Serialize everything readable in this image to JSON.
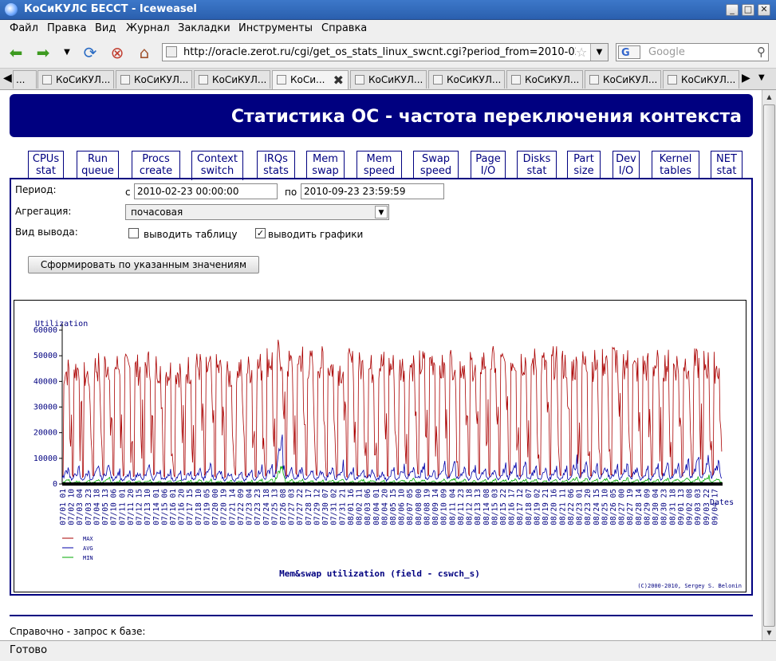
{
  "window": {
    "title": "КоСиКУЛС БЕССТ - Iceweasel"
  },
  "menu": [
    "Файл",
    "Правка",
    "Вид",
    "Журнал",
    "Закладки",
    "Инструменты",
    "Справка"
  ],
  "navbar": {
    "url": "http://oracle.zerot.ru/cgi/get_os_stats_linux_swcnt.cgi?period_from=2010-02-",
    "search_placeholder": "Google",
    "search_engine": "G"
  },
  "tabs": [
    {
      "label": "..."
    },
    {
      "label": "КоСиКУЛ..."
    },
    {
      "label": "КоСиКУЛ..."
    },
    {
      "label": "КоСиКУЛ..."
    },
    {
      "label": "КоСи..."
    },
    {
      "label": "КоСиКУЛ..."
    },
    {
      "label": "КоСиКУЛ..."
    },
    {
      "label": "КоСиКУЛ..."
    },
    {
      "label": "КоСиКУЛ..."
    },
    {
      "label": "КоСиКУЛ..."
    }
  ],
  "page": {
    "title": "Статистика ОС - частота переключения контекста",
    "subtabs": [
      {
        "l1": "CPUs",
        "l2": "stat"
      },
      {
        "l1": "Run",
        "l2": "queue"
      },
      {
        "l1": "Procs",
        "l2": "create"
      },
      {
        "l1": "Context",
        "l2": "switch"
      },
      {
        "l1": "IRQs",
        "l2": "stats"
      },
      {
        "l1": "Mem",
        "l2": "swap"
      },
      {
        "l1": "Mem",
        "l2": "speed"
      },
      {
        "l1": "Swap",
        "l2": "speed"
      },
      {
        "l1": "Page",
        "l2": "I/O"
      },
      {
        "l1": "Disks",
        "l2": "stat"
      },
      {
        "l1": "Part",
        "l2": "size"
      },
      {
        "l1": "Dev",
        "l2": "I/O"
      },
      {
        "l1": "Kernel",
        "l2": "tables"
      },
      {
        "l1": "NET",
        "l2": "stat"
      }
    ],
    "form": {
      "period_label": "Период:",
      "from_prefix": "с",
      "from_value": "2010-02-23 00:00:00",
      "to_prefix": "по",
      "to_value": "2010-09-23 23:59:59",
      "aggregation_label": "Агрегация:",
      "aggregation_value": "почасовая",
      "output_label": "Вид вывода:",
      "table_checkbox": "выводить таблицу",
      "graph_checkbox": "выводить графики",
      "table_checked": false,
      "graph_checked": true,
      "submit": "Сформировать по указанным значениям"
    },
    "note": "Справочно - запрос к базе:"
  },
  "chart_data": {
    "type": "line",
    "title": "Mem&swap utilization (field - cswch_s)",
    "ylabel": "Utilization",
    "xlabel": "Dates",
    "copyright": "(C)2000-2010, Sergey S. Belonin",
    "ylim": [
      0,
      60000
    ],
    "yticks": [
      0,
      10000,
      20000,
      30000,
      40000,
      50000,
      60000
    ],
    "x": [
      "07/01",
      "07/02",
      "07/03",
      "07/04",
      "07/05",
      "07/06",
      "07/08",
      "07/09",
      "07/10",
      "07/11",
      "07/12",
      "07/13",
      "07/14",
      "07/15",
      "07/16",
      "07/17",
      "07/18",
      "07/19",
      "07/20",
      "07/21",
      "07/22",
      "07/23",
      "07/24",
      "07/25",
      "07/26",
      "07/27",
      "07/28",
      "07/29",
      "07/30",
      "07/31",
      "08/01",
      "08/02",
      "08/03",
      "08/04",
      "08/05",
      "08/06",
      "08/07",
      "08/08",
      "08/09",
      "08/10",
      "08/11",
      "08/12",
      "08/13",
      "08/14",
      "08/15",
      "08/16",
      "08/17",
      "08/18",
      "08/19",
      "08/20",
      "08/21",
      "08/22",
      "08/23",
      "08/24",
      "08/25",
      "08/26",
      "08/27",
      "08/28",
      "08/29",
      "08/30",
      "08/31",
      "09/01",
      "09/02",
      "09/03",
      "09/04"
    ],
    "xtick_labels": [
      "07/01 01",
      "07/02 10",
      "07/03 04",
      "07/03 23",
      "07/04 18",
      "07/05 13",
      "07/10 06",
      "07/11 01",
      "07/11 20",
      "07/12 15",
      "07/13 10",
      "07/14 01",
      "07/15 06",
      "07/16 01",
      "07/16 20",
      "07/17 15",
      "07/18 10",
      "07/19 05",
      "07/20 00",
      "07/20 19",
      "07/21 14",
      "07/22 09",
      "07/23 04",
      "07/23 23",
      "07/24 18",
      "07/25 13",
      "07/26 08",
      "07/27 03",
      "07/27 22",
      "07/28 17",
      "07/29 12",
      "07/30 07",
      "07/31 02",
      "07/31 21",
      "08/01 16",
      "08/02 11",
      "08/03 06",
      "08/04 01",
      "08/04 20",
      "08/05 15",
      "08/06 10",
      "08/07 05",
      "08/08 00",
      "08/08 19",
      "08/09 14",
      "08/10 09",
      "08/11 04",
      "08/11 23",
      "08/12 18",
      "08/13 13",
      "08/14 08",
      "08/15 03",
      "08/15 22",
      "08/16 17",
      "08/17 12",
      "08/18 07",
      "08/19 02",
      "08/19 21",
      "08/20 16",
      "08/21 11",
      "08/22 06",
      "08/23 01",
      "08/23 20",
      "08/24 15",
      "08/25 10",
      "08/26 05",
      "08/27 00",
      "08/27 19",
      "08/28 14",
      "08/29 09",
      "08/30 04",
      "08/30 23",
      "08/31 18",
      "09/01 13",
      "09/02 08",
      "09/03 03",
      "09/03 22",
      "09/04 17"
    ],
    "series": [
      {
        "name": "MAX",
        "color": "#aa0000",
        "peaks": [
          50000,
          51000,
          48000,
          52000,
          53000,
          52000,
          51000,
          51000,
          53000,
          52000,
          50000,
          50000,
          51000,
          52000,
          51000,
          51000,
          48000,
          52000,
          51000,
          52000,
          55000,
          57000,
          53000,
          56000,
          53000,
          54000,
          52000,
          51000,
          53000,
          52000,
          51000,
          53000,
          52000,
          52000,
          53000,
          53000,
          55000,
          51000,
          54000,
          53000,
          53000,
          54000,
          54000,
          53000,
          56000,
          55000,
          54000,
          53000,
          54000,
          53000,
          52000,
          53000,
          53000,
          55000,
          56000,
          54000,
          51000,
          52000,
          53000,
          53000,
          53000,
          54000,
          53000,
          53000,
          52000
        ]
      },
      {
        "name": "AVG",
        "color": "#0000aa",
        "peaks": [
          8000,
          7000,
          6000,
          8000,
          9000,
          6000,
          5000,
          6000,
          8000,
          7000,
          6000,
          5000,
          6000,
          7000,
          9000,
          7000,
          6000,
          5000,
          6000,
          8000,
          9000,
          20000,
          7000,
          8000,
          6000,
          7000,
          8000,
          9000,
          7000,
          8000,
          7000,
          6000,
          7000,
          8000,
          9000,
          8000,
          7000,
          10000,
          9000,
          8000,
          7000,
          8000,
          7000,
          8000,
          10000,
          9000,
          8000,
          7000,
          8000,
          7000,
          11000,
          9000,
          8000,
          9000,
          8000,
          9000,
          8000,
          7000,
          8000,
          9000,
          9000,
          10000,
          11000,
          12000,
          10000
        ]
      },
      {
        "name": "MIN",
        "color": "#00aa00",
        "peaks": [
          2000,
          1500,
          1500,
          2000,
          2500,
          1500,
          1500,
          1500,
          2000,
          1500,
          1500,
          1500,
          1500,
          2000,
          2000,
          1500,
          1500,
          1500,
          1500,
          2000,
          2000,
          9000,
          2000,
          2000,
          1500,
          1500,
          2000,
          2000,
          1500,
          2000,
          2000,
          1500,
          1500,
          2000,
          2500,
          2000,
          1500,
          2000,
          2500,
          2000,
          1500,
          2000,
          2000,
          2000,
          2500,
          2000,
          2000,
          1500,
          2000,
          2000,
          3000,
          2500,
          2000,
          2500,
          2000,
          2500,
          2000,
          2000,
          2000,
          2500,
          2500,
          3000,
          3000,
          3500,
          2500
        ]
      }
    ],
    "legend_position": "bottom-left"
  }
}
